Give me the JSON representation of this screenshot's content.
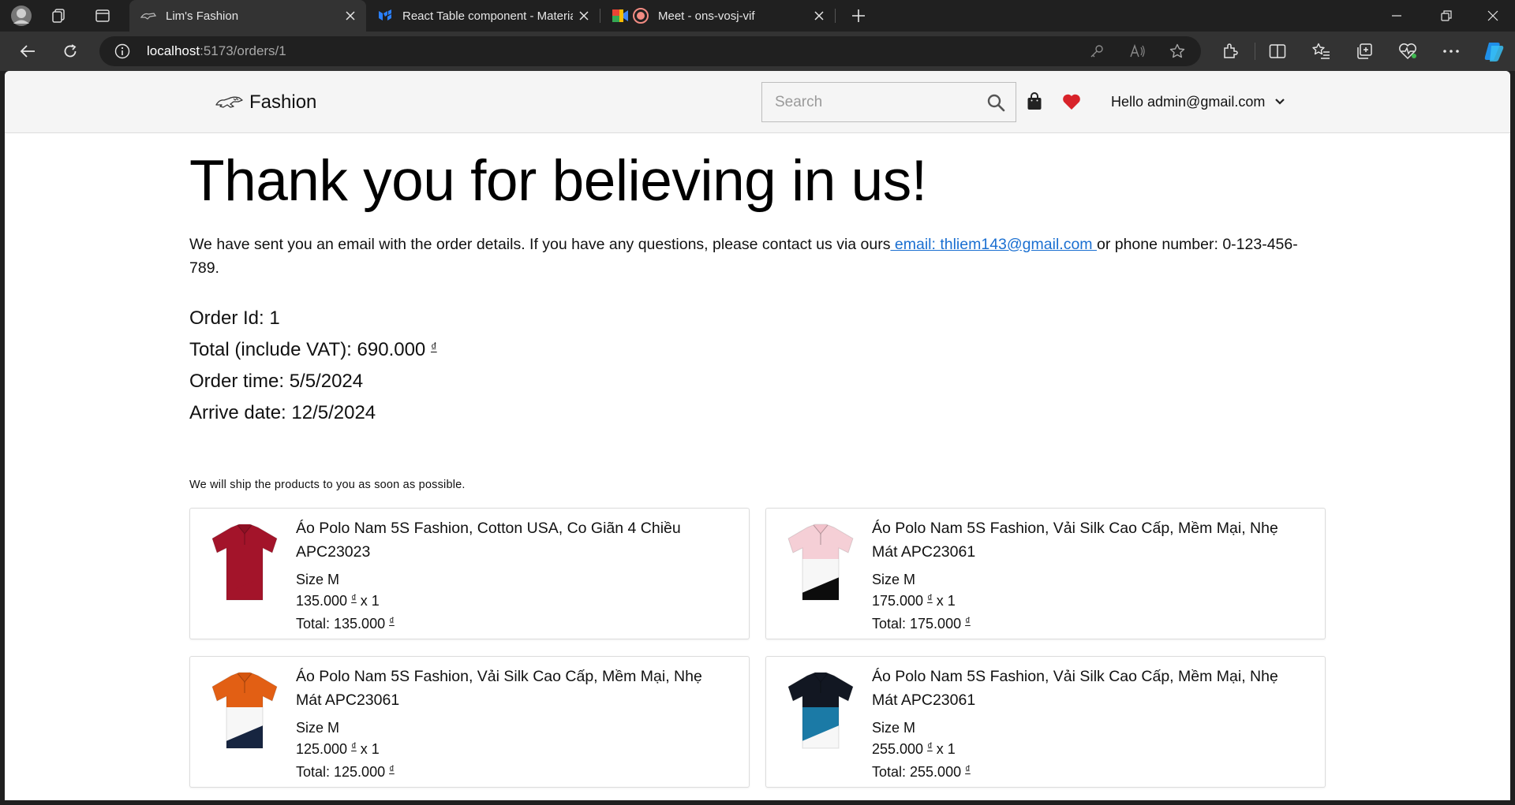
{
  "browser": {
    "tabs": [
      {
        "title": "Lim's Fashion",
        "active": true
      },
      {
        "title": "React Table component - Materia",
        "active": false
      },
      {
        "title": "Meet - ons-vosj-vif",
        "active": false
      }
    ],
    "url": {
      "host": "localhost",
      "rest": ":5173/orders/1"
    }
  },
  "site": {
    "brand": "Fashion",
    "search": {
      "placeholder": "Search"
    },
    "user_greeting": "Hello admin@gmail.com"
  },
  "order": {
    "heading": "Thank you for believing in us!",
    "message_before": "We have sent you an email with the order details. If you have any questions, please contact us via ours",
    "email_link": " email: thliem143@gmail.com ",
    "message_after": "or phone number: 0-123-456-789.",
    "order_id": "Order Id: 1",
    "total_label": "Total (include VAT): 690.000",
    "currency": "₫",
    "order_time": "Order time: 5/5/2024",
    "arrive_date": "Arrive date: 12/5/2024",
    "ship_note": "We will ship the products to you as soon as possible."
  },
  "items": [
    {
      "name": "Áo Polo Nam 5S Fashion, Cotton USA, Co Giãn 4 Chiều APC23023",
      "size": "Size M",
      "price": "135.000",
      "qty": "x 1",
      "total": "Total: 135.000",
      "shirt": {
        "top": "#a3142a",
        "mid": "#a3142a",
        "bottom": "#a3142a",
        "collar": "#8d1024"
      }
    },
    {
      "name": "Áo Polo Nam 5S Fashion, Vải Silk Cao Cấp, Mềm Mại, Nhẹ Mát APC23061",
      "size": "Size M",
      "price": "175.000",
      "qty": "x 1",
      "total": "Total: 175.000",
      "shirt": {
        "top": "#f5cfd6",
        "mid": "#f7f7f7",
        "bottom": "#0c0c0c",
        "collar": "#f2c2cb"
      }
    },
    {
      "name": "Áo Polo Nam 5S Fashion, Vải Silk Cao Cấp, Mềm Mại, Nhẹ Mát APC23061",
      "size": "Size M",
      "price": "125.000",
      "qty": "x 1",
      "total": "Total: 125.000",
      "shirt": {
        "top": "#e25f14",
        "mid": "#f7f7f7",
        "bottom": "#172540",
        "collar": "#d4550f"
      }
    },
    {
      "name": "Áo Polo Nam 5S Fashion, Vải Silk Cao Cấp, Mềm Mại, Nhẹ Mát APC23061",
      "size": "Size M",
      "price": "255.000",
      "qty": "x 1",
      "total": "Total: 255.000",
      "shirt": {
        "top": "#121722",
        "mid": "#1b7aa6",
        "bottom": "#f7f7f7",
        "collar": "#121722"
      }
    }
  ]
}
